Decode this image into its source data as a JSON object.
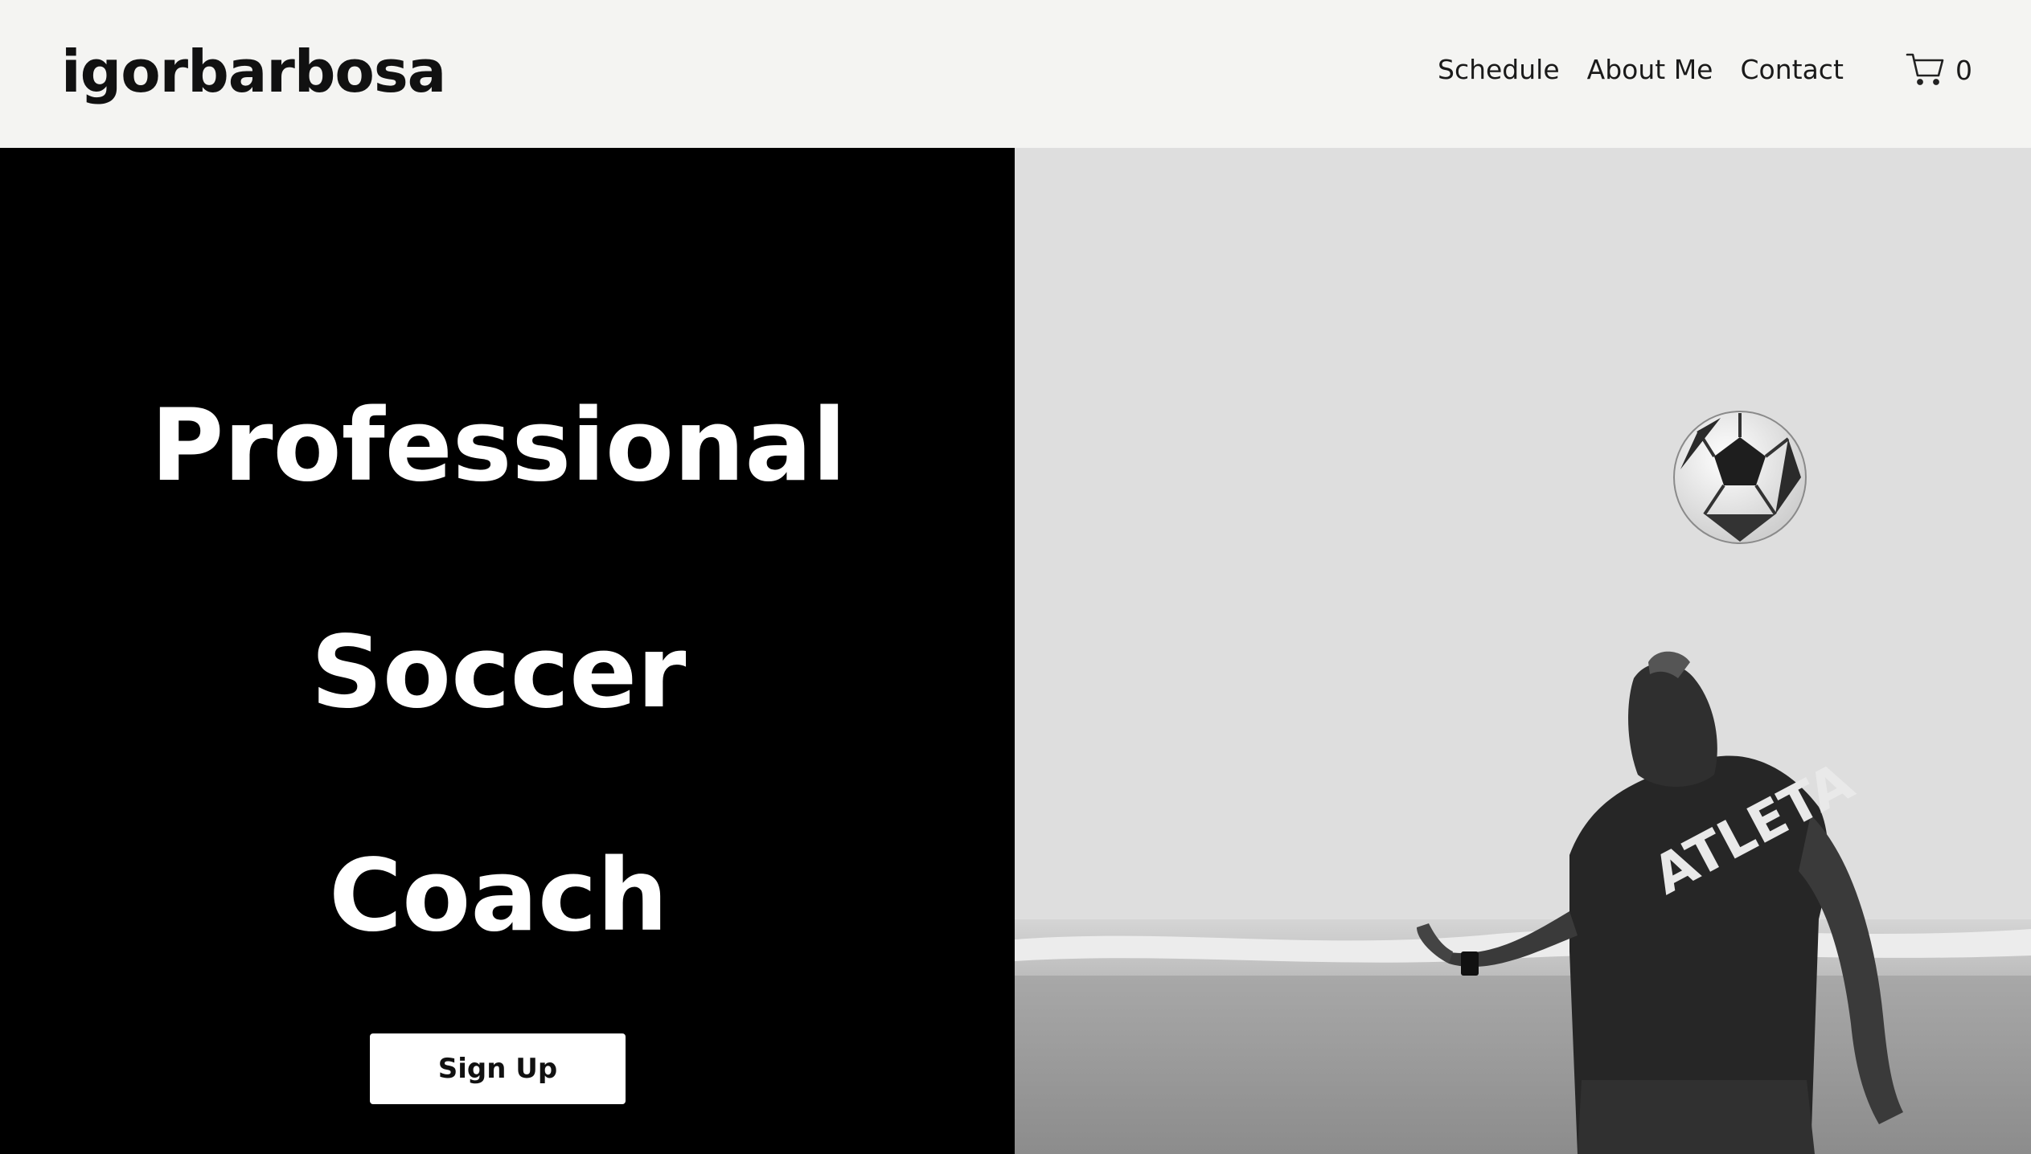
{
  "header": {
    "logo": "igorbarbosa",
    "nav": [
      "Schedule",
      "About Me",
      "Contact"
    ],
    "cart_count": "0"
  },
  "hero": {
    "headline": [
      "Professional",
      "Soccer",
      "Coach"
    ],
    "cta_label": "Sign Up",
    "photo_text": "ATLETA"
  }
}
